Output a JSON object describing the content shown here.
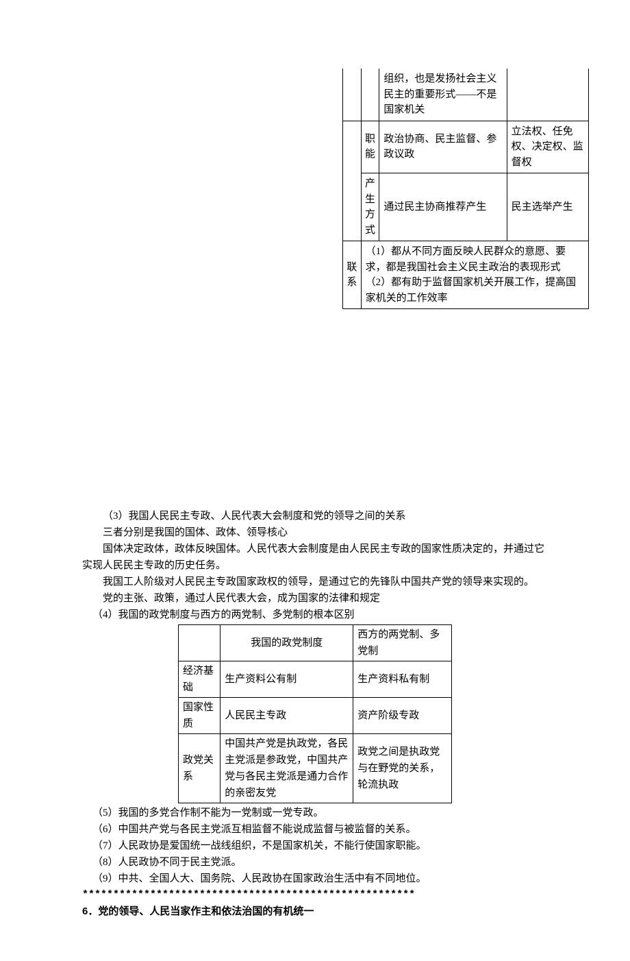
{
  "table1": {
    "r1_c2": "组织，也是发扬社会主义民主的重要形式——不是国家机关",
    "r1_c3": "",
    "r2_label": "职能",
    "r2_c2": "政治协商、民主监督、参政议政",
    "r2_c3": "立法权、任免权、决定权、监督权",
    "r3_label": "产生方式",
    "r3_c2": "通过民主协商推荐产生",
    "r3_c3": "民主选举产生",
    "r4_label": "联系",
    "r4_body": "（1）都从不同方面反映人民群众的意愿、要求，都是我国社会主义民主政治的表现形式\n（2）都有助于监督国家机关开展工作，提高国家机关的工作效率"
  },
  "para": {
    "p1": "（3）我国人民民主专政、人民代表大会制度和党的领导之间的关系",
    "p2": "三者分别是我国的国体、政体、领导核心",
    "p3": "国体决定政体，政体反映国体。人民代表大会制度是由人民民主专政的国家性质决定的，并通过它实现人民民主专政的历史任务。",
    "p4": "我国工人阶级对人民民主专政国家政权的领导，是通过它的先锋队中国共产党的领导来实现的。",
    "p5": "党的主张、政策，通过人民代表大会，成为国家的法律和规定",
    "p6": "（4）我国的政党制度与西方的两党制、多党制的根本区别"
  },
  "table2": {
    "h1": "我国的政党制度",
    "h2": "西方的两党制、多党制",
    "r1_label": "经济基础",
    "r1_c1": "生产资料公有制",
    "r1_c2": "生产资料私有制",
    "r2_label": "国家性质",
    "r2_c1": "人民民主专政",
    "r2_c2": "资产阶级专政",
    "r3_label": "政党关系",
    "r3_c1": "中国共产党是执政党，各民主党派是参政党，中国共产党与各民主党派是通力合作的亲密友党",
    "r3_c2": "政党之间是执政党与在野党的关系，轮流执政"
  },
  "para2": {
    "p7": "（5）我国的多党合作制不能为一党制或一党专政。",
    "p8": "（6）中国共产党与各民主党派互相监督不能说成监督与被监督的关系。",
    "p9": "（7）人民政协是爱国统一战线组织，不是国家机关，不能行使国家职能。",
    "p10": "（8）人民政协不同于民主党派。",
    "p11": "（9）中共、全国人大、国务院、人民政协在国家政治生活中有不同地位。",
    "stars": "******************************************************",
    "heading": "6．党的领导、人民当家作主和依法治国的有机统一"
  }
}
